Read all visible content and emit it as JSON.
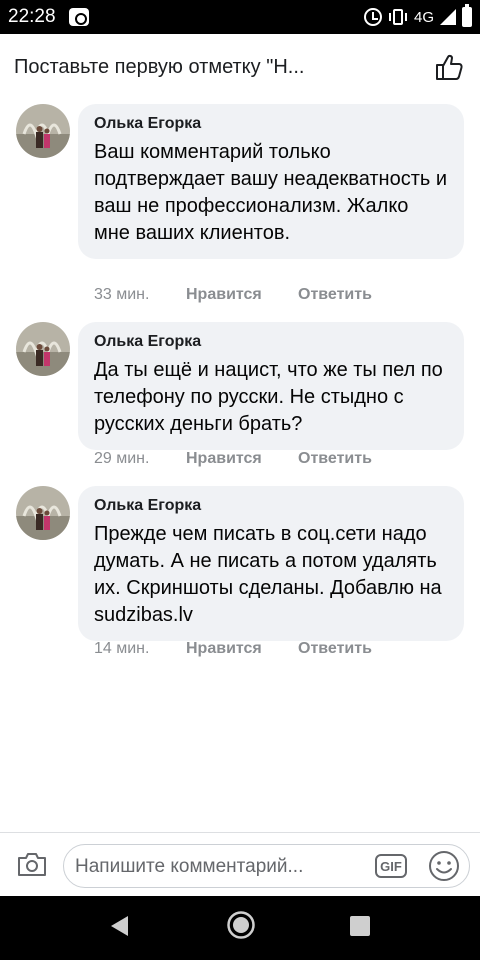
{
  "status_bar": {
    "time": "22:28",
    "network": "4G"
  },
  "header": {
    "title": "Поставьте первую отметку \"Н..."
  },
  "comments": [
    {
      "author": "Олька Егорка",
      "text": "Ваш комментарий только подтверждает вашу неадекватность и ваш не профессионализм. Жалко мне ваших клиентов.",
      "time": "33 мин.",
      "like_label": "Нравится",
      "reply_label": "Ответить"
    },
    {
      "author": "Олька Егорка",
      "text": "Да ты ещё и нацист, что же ты пел по телефону по русски. Не стыдно с русских деньги брать?",
      "time": "29 мин.",
      "like_label": "Нравится",
      "reply_label": "Ответить"
    },
    {
      "author": "Олька Егорка",
      "text": "Прежде чем писать в соц.сети надо думать. А не писать а потом удалять их. Скриншоты сделаны. Добавлю на sudzibas.lv",
      "time": "14 мин.",
      "like_label": "Нравится",
      "reply_label": "Ответить"
    }
  ],
  "composer": {
    "placeholder": "Напишите комментарий...",
    "gif_label": "GIF"
  },
  "icons": {
    "like": "thumbs-up-icon",
    "camera": "camera-icon",
    "emoji": "emoji-icon"
  },
  "colors": {
    "bubble": "#f0f2f5",
    "meta": "#8a8d91"
  }
}
